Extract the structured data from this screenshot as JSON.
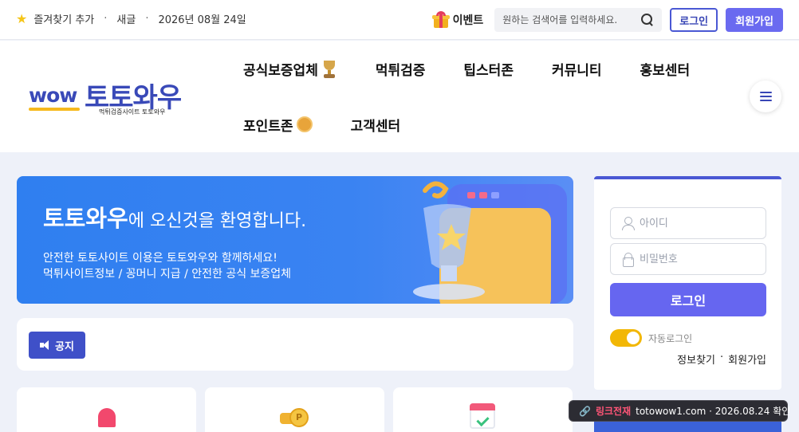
{
  "topbar": {
    "bookmark": "즐겨찾기 추가",
    "sep": "·",
    "new_posts": "새글",
    "date": "2026년 08월 24일",
    "event": "이벤트",
    "search_placeholder": "원하는 검색어를 입력하세요.",
    "login": "로그인",
    "join": "회원가입"
  },
  "logo": {
    "wow": "wow",
    "main": "토토와우",
    "sub": "먹튀검증사이트 토토와우"
  },
  "nav": {
    "row1": [
      "공식보증업체",
      "먹튀검증",
      "팁스터존",
      "커뮤니티",
      "홍보센터"
    ],
    "row2": [
      "포인트존",
      "고객센터"
    ]
  },
  "banner": {
    "title_bold": "토토와우",
    "title_rest": "에 오신것을 환영합니다.",
    "line1": "안전한 토토사이트 이용은 토토와우와 함께하세요!",
    "line2": "먹튀사이트정보 / 꽁머니 지급 / 안전한 공식 보증업체"
  },
  "notice": {
    "label": "공지"
  },
  "login_panel": {
    "id_placeholder": "아이디",
    "pw_placeholder": "비밀번호",
    "submit": "로그인",
    "auto_login": "자동로그인",
    "find": "정보찾기",
    "sep": "·",
    "join": "회원가입"
  },
  "toast": {
    "label": "링크전재",
    "text": "totowow1.com · 2026.08.24 확인"
  },
  "icons": [
    "star-icon",
    "gift-icon",
    "search-icon",
    "trophy-icon",
    "coin-icon",
    "hamburger-icon",
    "speaker-icon",
    "siren-icon",
    "coins-icon",
    "calendar-icon",
    "user-icon",
    "lock-icon",
    "link-icon"
  ],
  "colors": {
    "brand": "#3949b8",
    "accent": "#6666f0",
    "banner": "#2f7ff0",
    "toggle": "#f2b705"
  }
}
